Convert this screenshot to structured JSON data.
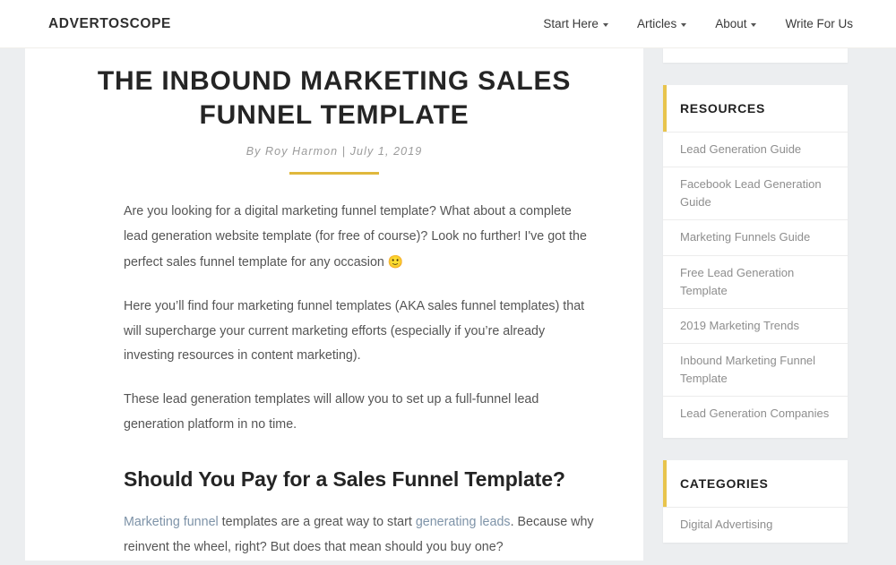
{
  "header": {
    "logo": "ADVERTOSCOPE",
    "nav": [
      {
        "label": "Start Here",
        "has_dropdown": true
      },
      {
        "label": "Articles",
        "has_dropdown": true
      },
      {
        "label": "About",
        "has_dropdown": true
      },
      {
        "label": "Write For Us",
        "has_dropdown": false
      }
    ]
  },
  "article": {
    "title": "THE INBOUND MARKETING SALES FUNNEL TEMPLATE",
    "byline": "By Roy Harmon | July 1, 2019",
    "paragraph_1_a": "Are you looking for a digital marketing funnel template? What about a complete lead generation website template (for free of course)? Look no further! I've got the perfect sales funnel template for any occasion ",
    "paragraph_1_emoji": "🙂",
    "paragraph_2": "Here you’ll find four marketing funnel templates (AKA sales funnel templates) that will supercharge your current marketing efforts (especially if you’re already investing resources in content marketing).",
    "paragraph_3": "These lead generation templates will allow you to set up a full-funnel lead generation platform in no time.",
    "heading_1": "Should You Pay for a Sales Funnel Template?",
    "paragraph_4_link_1": "Marketing funnel",
    "paragraph_4_mid": " templates are a great way to start ",
    "paragraph_4_link_2": "generating leads",
    "paragraph_4_tail": ". Because why reinvent the wheel, right? But does that mean should you buy one?"
  },
  "sidebar": {
    "resources": {
      "title": "RESOURCES",
      "items": [
        "Lead Generation Guide",
        "Facebook Lead Generation Guide",
        "Marketing Funnels Guide",
        "Free Lead Generation Template",
        "2019 Marketing Trends",
        "Inbound Marketing Funnel Template",
        "Lead Generation Companies"
      ]
    },
    "categories": {
      "title": "CATEGORIES",
      "items": [
        "Digital Advertising"
      ]
    }
  },
  "colors": {
    "accent_gold": "#e8c44d",
    "divider_gold": "#e0b83c",
    "page_background": "#eceef0",
    "link": "#7e93a8",
    "body_text": "#555555"
  }
}
